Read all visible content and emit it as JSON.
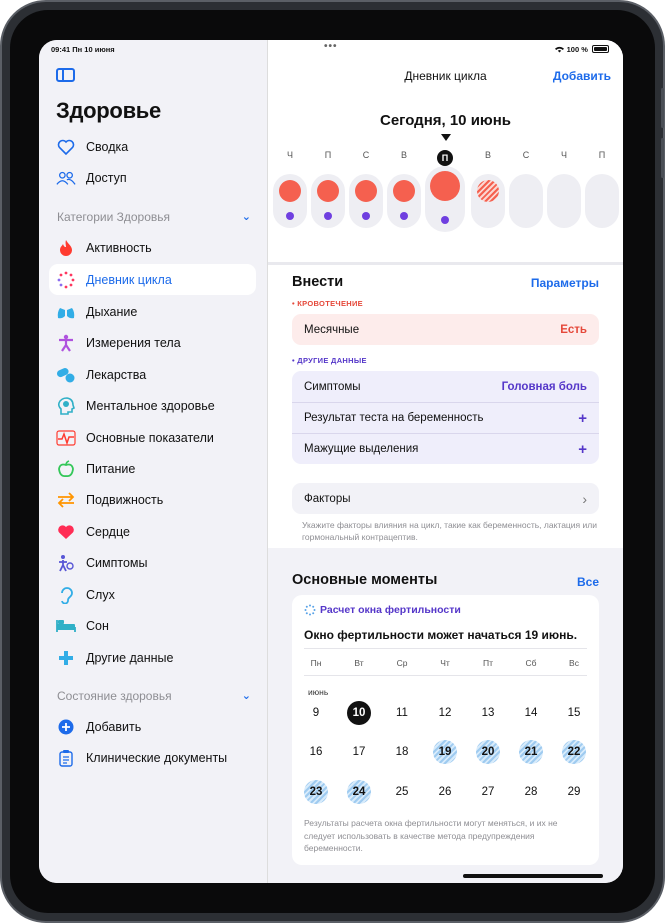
{
  "status": {
    "time": "09:41",
    "date": "Пн 10 июня",
    "wifi": "wifi-icon",
    "battery": "100 %"
  },
  "sidebar": {
    "title": "Здоровье",
    "top_items": [
      {
        "label": "Сводка",
        "icon": "heart-icon"
      },
      {
        "label": "Доступ",
        "icon": "people-icon"
      }
    ],
    "categories_header": "Категории Здоровья",
    "categories": [
      {
        "label": "Активность",
        "icon": "flame-icon",
        "color": "#ff3b30"
      },
      {
        "label": "Дневник цикла",
        "icon": "cycle-icon",
        "color": "#ff375f",
        "selected": true
      },
      {
        "label": "Дыхание",
        "icon": "lungs-icon",
        "color": "#32ade6"
      },
      {
        "label": "Измерения тела",
        "icon": "figure-icon",
        "color": "#af52de"
      },
      {
        "label": "Лекарства",
        "icon": "pills-icon",
        "color": "#32ade6"
      },
      {
        "label": "Ментальное здоровье",
        "icon": "brain-head-icon",
        "color": "#30b0c7"
      },
      {
        "label": "Основные показатели",
        "icon": "waveform-icon",
        "color": "#ff3b30"
      },
      {
        "label": "Питание",
        "icon": "apple-icon",
        "color": "#34c759"
      },
      {
        "label": "Подвижность",
        "icon": "arrows-icon",
        "color": "#ff9500"
      },
      {
        "label": "Сердце",
        "icon": "heart-filled-icon",
        "color": "#ff2d55"
      },
      {
        "label": "Симптомы",
        "icon": "figure-symptoms-icon",
        "color": "#5856d6"
      },
      {
        "label": "Слух",
        "icon": "ear-icon",
        "color": "#32ade6"
      },
      {
        "label": "Сон",
        "icon": "bed-icon",
        "color": "#30b0c7"
      },
      {
        "label": "Другие данные",
        "icon": "plus-cross-icon",
        "color": "#32ade6"
      }
    ],
    "health_header": "Состояние здоровья",
    "health_items": [
      {
        "label": "Добавить",
        "icon": "plus-circle-icon"
      },
      {
        "label": "Клинические документы",
        "icon": "clipboard-icon"
      }
    ]
  },
  "main": {
    "nav_title": "Дневник цикла",
    "add_button": "Добавить",
    "today_label": "Сегодня, 10 июнь",
    "week_days": [
      "Ч",
      "П",
      "С",
      "В",
      "П",
      "В",
      "С",
      "Ч",
      "П"
    ],
    "log": {
      "title": "Внести",
      "params_link": "Параметры",
      "bleeding_caption": "• КРОВОТЕЧЕНИЕ",
      "period_label": "Месячные",
      "period_value": "Есть",
      "other_caption": "• ДРУГИЕ ДАННЫЕ",
      "rows": [
        {
          "label": "Симптомы",
          "value": "Головная боль"
        },
        {
          "label": "Результат теста на беременность",
          "value": "+"
        },
        {
          "label": "Мажущие выделения",
          "value": "+"
        }
      ],
      "factors_label": "Факторы",
      "factors_note": "Укажите факторы влияния на цикл, такие как беременность, лактация или гормональный контрацептив."
    },
    "highlights": {
      "title": "Основные моменты",
      "all_link": "Все",
      "card_title": "Расчет окна фертильности",
      "card_text": "Окно фертильности может начаться 19 июнь.",
      "weekdays": [
        "Пн",
        "Вт",
        "Ср",
        "Чт",
        "Пт",
        "Сб",
        "Вс"
      ],
      "month": "июнь",
      "weeks": [
        [
          "9",
          "10",
          "11",
          "12",
          "13",
          "14",
          "15"
        ],
        [
          "16",
          "17",
          "18",
          "19",
          "20",
          "21",
          "22"
        ],
        [
          "23",
          "24",
          "25",
          "26",
          "27",
          "28",
          "29"
        ]
      ],
      "today": "10",
      "fertile_days": [
        "19",
        "20",
        "21",
        "22",
        "23",
        "24"
      ],
      "disclaimer": "Результаты расчета окна фертильности могут меняться, и их не следует использовать в качестве метода предупреждения беременности."
    }
  }
}
